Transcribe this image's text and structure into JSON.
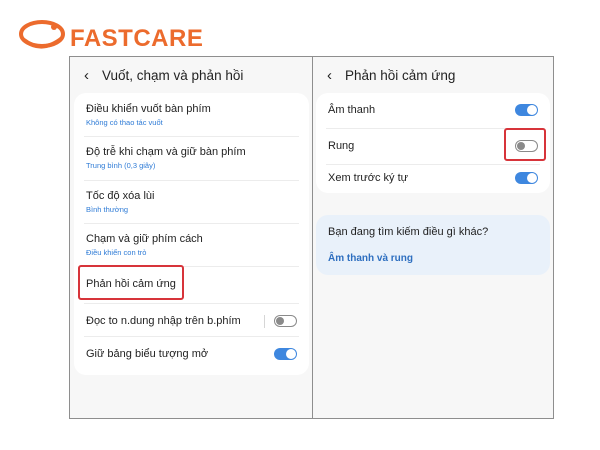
{
  "logo": {
    "brand": "FASTCARE",
    "accent": "#ec6b2d"
  },
  "left_panel": {
    "title": "Vuốt, chạm và phản hồi",
    "items": [
      {
        "title": "Điều khiển vuốt bàn phím",
        "subtitle": "Không có thao tác vuốt"
      },
      {
        "title": "Độ trễ khi chạm và giữ bàn phím",
        "subtitle": "Trung bình (0,3 giây)"
      },
      {
        "title": "Tốc độ xóa lùi",
        "subtitle": "Bình thường"
      },
      {
        "title": "Chạm và giữ phím cách",
        "subtitle": "Điều khiển con trỏ"
      },
      {
        "title": "Phản hồi cảm ứng",
        "highlighted": true
      }
    ],
    "toggles": [
      {
        "label": "Đọc to n.dung nhập trên b.phím",
        "state": "off"
      },
      {
        "label": "Giữ bảng biểu tượng mở",
        "state": "on"
      }
    ]
  },
  "right_panel": {
    "title": "Phản hồi cảm ứng",
    "toggles": [
      {
        "label": "Âm thanh",
        "state": "on"
      },
      {
        "label": "Rung",
        "state": "off",
        "highlighted": true
      },
      {
        "label": "Xem trước ký tự",
        "state": "on"
      }
    ],
    "suggest": {
      "question": "Bạn đang tìm kiếm điều gì khác?",
      "link": "Âm thanh và rung"
    }
  },
  "colors": {
    "toggle_on": "#3e87df",
    "highlight": "#d7343a",
    "link": "#2e7bd6"
  }
}
